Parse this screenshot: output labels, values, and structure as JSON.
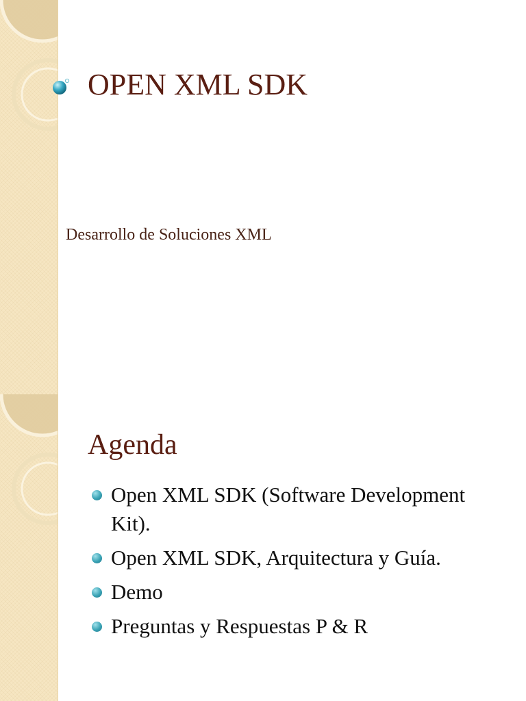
{
  "slides": [
    {
      "title": "OPEN XML SDK",
      "subtitle": "Desarrollo de Soluciones XML"
    },
    {
      "title": "Agenda",
      "items": [
        {
          "text": "Open XML SDK (Software Development Kit)."
        },
        {
          "text": "Open XML SDK, Arquitectura y Guía."
        },
        {
          "text": "Demo"
        },
        {
          "text": "Preguntas y Respuestas P & R"
        }
      ]
    }
  ],
  "theme": {
    "title_color": "#5a1e12",
    "band_color": "#f6e6c2",
    "bullet_color": "#3aa3b5"
  },
  "icons": {
    "title_bullet": "sphere-bullet-icon",
    "list_bullet": "round-bullet-icon",
    "band_ornament": "concentric-circles-ornament"
  }
}
